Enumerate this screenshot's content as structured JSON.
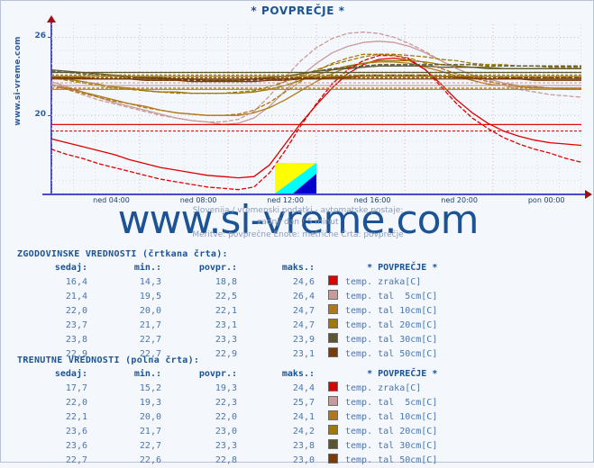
{
  "chart_data": {
    "type": "line",
    "title": "* POVPREČJE *",
    "subtitle_line1": "Slovenija / vremenski podatki - avtomatske postaje:",
    "subtitle_line2": "zadnji dan / 5 minut",
    "subtitle_line3": "Meritve: povprečne  Enote: metrične  Črta: povprečje",
    "xlabel": "",
    "ylabel": "",
    "ylim": [
      14,
      27
    ],
    "yticks": [
      20,
      26
    ],
    "ytick_labels": [
      "20",
      "26"
    ],
    "xticks": [
      "ned 04:00",
      "ned 08:00",
      "ned 12:00",
      "ned 16:00",
      "ned 20:00",
      "pon 00:00"
    ],
    "grid": true,
    "legend_position": "below-table",
    "series": [
      {
        "name": "temp. zraka[C]",
        "style": "solid",
        "group": "trenutne",
        "color": "#dd0000",
        "values": [
          18.2,
          17.9,
          17.6,
          17.3,
          17.0,
          16.6,
          16.3,
          16.0,
          15.8,
          15.6,
          15.4,
          15.3,
          15.2,
          15.3,
          16.2,
          17.8,
          19.4,
          20.8,
          22.1,
          23.2,
          23.9,
          24.3,
          24.4,
          24.2,
          23.5,
          22.4,
          21.2,
          20.2,
          19.4,
          18.8,
          18.4,
          18.1,
          17.9,
          17.8,
          17.7
        ]
      },
      {
        "name": "temp. tal  5cm[C]",
        "style": "solid",
        "group": "trenutne",
        "color": "#c99a9a",
        "values": [
          22.6,
          22.2,
          21.8,
          21.4,
          21.0,
          20.7,
          20.4,
          20.1,
          19.8,
          19.6,
          19.5,
          19.3,
          19.4,
          19.8,
          20.7,
          21.9,
          23.0,
          24.0,
          24.8,
          25.3,
          25.6,
          25.7,
          25.6,
          25.3,
          24.8,
          24.2,
          23.6,
          23.1,
          22.8,
          22.5,
          22.3,
          22.2,
          22.1,
          22.0,
          22.0
        ]
      },
      {
        "name": "temp. tal 10cm[C]",
        "style": "solid",
        "group": "trenutne",
        "color": "#b07818",
        "values": [
          22.4,
          22.1,
          21.8,
          21.5,
          21.2,
          20.9,
          20.7,
          20.4,
          20.2,
          20.1,
          20.0,
          20.0,
          20.0,
          20.2,
          20.6,
          21.2,
          21.9,
          22.6,
          23.2,
          23.7,
          24.0,
          24.1,
          24.1,
          24.0,
          23.7,
          23.4,
          23.0,
          22.7,
          22.4,
          22.3,
          22.2,
          22.1,
          22.1,
          22.1,
          22.1
        ]
      },
      {
        "name": "temp. tal 20cm[C]",
        "style": "solid",
        "group": "trenutne",
        "color": "#a07806",
        "values": [
          23.0,
          22.8,
          22.6,
          22.4,
          22.2,
          22.1,
          21.9,
          21.8,
          21.8,
          21.7,
          21.7,
          21.7,
          21.7,
          21.8,
          22.0,
          22.3,
          22.7,
          23.1,
          23.5,
          23.8,
          24.0,
          24.2,
          24.2,
          24.2,
          24.1,
          23.9,
          23.8,
          23.7,
          23.7,
          23.6,
          23.6,
          23.6,
          23.6,
          23.6,
          23.6
        ]
      },
      {
        "name": "temp. tal 30cm[C]",
        "style": "solid",
        "group": "trenutne",
        "color": "#5c5630",
        "values": [
          23.5,
          23.4,
          23.3,
          23.2,
          23.1,
          23.0,
          22.9,
          22.9,
          22.8,
          22.8,
          22.7,
          22.7,
          22.7,
          22.8,
          22.9,
          23.0,
          23.2,
          23.4,
          23.5,
          23.6,
          23.7,
          23.8,
          23.8,
          23.8,
          23.8,
          23.7,
          23.7,
          23.7,
          23.6,
          23.6,
          23.6,
          23.6,
          23.6,
          23.6,
          23.6
        ]
      },
      {
        "name": "temp. tal 50cm[C]",
        "style": "solid",
        "group": "trenutne",
        "color": "#7a3b06",
        "values": [
          22.9,
          22.9,
          22.9,
          22.8,
          22.8,
          22.8,
          22.7,
          22.7,
          22.7,
          22.6,
          22.6,
          22.6,
          22.6,
          22.6,
          22.7,
          22.7,
          22.8,
          22.8,
          22.9,
          22.9,
          23.0,
          23.0,
          23.0,
          23.0,
          23.0,
          23.0,
          22.9,
          22.9,
          22.8,
          22.8,
          22.8,
          22.7,
          22.7,
          22.7,
          22.7
        ]
      },
      {
        "name": "temp. zraka[C]",
        "style": "dashed",
        "group": "zgodovinske",
        "color": "#dd0000",
        "values": [
          17.4,
          17.0,
          16.7,
          16.3,
          16.0,
          15.7,
          15.4,
          15.1,
          14.9,
          14.7,
          14.5,
          14.4,
          14.3,
          14.5,
          15.6,
          17.3,
          19.2,
          20.9,
          22.4,
          23.5,
          24.2,
          24.6,
          24.6,
          24.3,
          23.5,
          22.2,
          20.9,
          19.8,
          19.0,
          18.3,
          17.8,
          17.4,
          17.1,
          16.7,
          16.4
        ]
      },
      {
        "name": "temp. tal  5cm[C]",
        "style": "dashed",
        "group": "zgodovinske",
        "color": "#c99a9a",
        "values": [
          22.4,
          22.0,
          21.6,
          21.2,
          20.9,
          20.6,
          20.3,
          20.0,
          19.8,
          19.6,
          19.5,
          19.5,
          19.7,
          20.3,
          21.5,
          22.9,
          24.2,
          25.2,
          25.9,
          26.3,
          26.4,
          26.3,
          26.0,
          25.5,
          24.9,
          24.2,
          23.6,
          23.1,
          22.7,
          22.3,
          22.0,
          21.8,
          21.6,
          21.5,
          21.4
        ]
      },
      {
        "name": "temp. tal 10cm[C]",
        "style": "dashed",
        "group": "zgodovinske",
        "color": "#b07818",
        "values": [
          22.3,
          22.0,
          21.7,
          21.4,
          21.1,
          20.9,
          20.6,
          20.4,
          20.2,
          20.1,
          20.0,
          20.0,
          20.1,
          20.4,
          21.0,
          21.8,
          22.6,
          23.4,
          24.0,
          24.4,
          24.7,
          24.7,
          24.6,
          24.4,
          24.0,
          23.6,
          23.2,
          22.9,
          22.6,
          22.4,
          22.3,
          22.2,
          22.1,
          22.0,
          22.0
        ]
      },
      {
        "name": "temp. tal 20cm[C]",
        "style": "dashed",
        "group": "zgodovinske",
        "color": "#a07806",
        "values": [
          22.9,
          22.7,
          22.5,
          22.3,
          22.1,
          22.0,
          21.9,
          21.8,
          21.7,
          21.7,
          21.7,
          21.7,
          21.8,
          21.9,
          22.2,
          22.6,
          23.0,
          23.5,
          23.9,
          24.2,
          24.5,
          24.7,
          24.7,
          24.6,
          24.5,
          24.3,
          24.2,
          24.0,
          23.9,
          23.9,
          23.8,
          23.8,
          23.7,
          23.7,
          23.7
        ]
      },
      {
        "name": "temp. tal 30cm[C]",
        "style": "dashed",
        "group": "zgodovinske",
        "color": "#5c5630",
        "values": [
          23.4,
          23.3,
          23.2,
          23.1,
          23.0,
          22.9,
          22.9,
          22.8,
          22.8,
          22.7,
          22.7,
          22.7,
          22.7,
          22.8,
          22.9,
          23.0,
          23.2,
          23.4,
          23.6,
          23.7,
          23.8,
          23.9,
          23.9,
          23.9,
          23.9,
          23.9,
          23.9,
          23.9,
          23.8,
          23.8,
          23.8,
          23.8,
          23.8,
          23.8,
          23.8
        ]
      },
      {
        "name": "temp. tal 50cm[C]",
        "style": "dashed",
        "group": "zgodovinske",
        "color": "#7a3b06",
        "values": [
          22.9,
          22.9,
          22.8,
          22.8,
          22.8,
          22.8,
          22.7,
          22.7,
          22.7,
          22.7,
          22.7,
          22.7,
          22.7,
          22.7,
          22.8,
          22.8,
          22.9,
          22.9,
          23.0,
          23.0,
          23.1,
          23.1,
          23.1,
          23.1,
          23.1,
          23.0,
          23.0,
          23.0,
          23.0,
          22.9,
          22.9,
          22.9,
          22.9,
          22.9,
          22.9
        ]
      }
    ]
  },
  "vertical_label": "www.si-vreme.com",
  "watermark": "www.si-vreme.com",
  "logo": {
    "name": "si-vreme-logo",
    "colors": [
      "#ffff00",
      "#00ffff",
      "#0000cc"
    ]
  },
  "tables": {
    "historical": {
      "caption": "ZGODOVINSKE VREDNOSTI (črtkana črta):",
      "headers": {
        "now": "sedaj:",
        "min": "min.:",
        "avg": "povpr.:",
        "max": "maks.:",
        "series": "* POVPREČJE *"
      },
      "rows": [
        {
          "now": "16,4",
          "min": "14,3",
          "avg": "18,8",
          "max": "24,6",
          "color": "#dd0000",
          "label": "temp. zraka[C]"
        },
        {
          "now": "21,4",
          "min": "19,5",
          "avg": "22,5",
          "max": "26,4",
          "color": "#c99a9a",
          "label": "temp. tal  5cm[C]"
        },
        {
          "now": "22,0",
          "min": "20,0",
          "avg": "22,1",
          "max": "24,7",
          "color": "#b07818",
          "label": "temp. tal 10cm[C]"
        },
        {
          "now": "23,7",
          "min": "21,7",
          "avg": "23,1",
          "max": "24,7",
          "color": "#a07806",
          "label": "temp. tal 20cm[C]"
        },
        {
          "now": "23,8",
          "min": "22,7",
          "avg": "23,3",
          "max": "23,9",
          "color": "#5c5630",
          "label": "temp. tal 30cm[C]"
        },
        {
          "now": "22,9",
          "min": "22,7",
          "avg": "22,9",
          "max": "23,1",
          "color": "#7a3b06",
          "label": "temp. tal 50cm[C]"
        }
      ]
    },
    "current": {
      "caption": "TRENUTNE VREDNOSTI (polna črta):",
      "headers": {
        "now": "sedaj:",
        "min": "min.:",
        "avg": "povpr.:",
        "max": "maks.:",
        "series": "* POVPREČJE *"
      },
      "rows": [
        {
          "now": "17,7",
          "min": "15,2",
          "avg": "19,3",
          "max": "24,4",
          "color": "#dd0000",
          "label": "temp. zraka[C]"
        },
        {
          "now": "22,0",
          "min": "19,3",
          "avg": "22,3",
          "max": "25,7",
          "color": "#c99a9a",
          "label": "temp. tal  5cm[C]"
        },
        {
          "now": "22,1",
          "min": "20,0",
          "avg": "22,0",
          "max": "24,1",
          "color": "#b07818",
          "label": "temp. tal 10cm[C]"
        },
        {
          "now": "23,6",
          "min": "21,7",
          "avg": "23,0",
          "max": "24,2",
          "color": "#a07806",
          "label": "temp. tal 20cm[C]"
        },
        {
          "now": "23,6",
          "min": "22,7",
          "avg": "23,3",
          "max": "23,8",
          "color": "#5c5630",
          "label": "temp. tal 30cm[C]"
        },
        {
          "now": "22,7",
          "min": "22,6",
          "avg": "22,8",
          "max": "23,0",
          "color": "#7a3b06",
          "label": "temp. tal 50cm[C]"
        }
      ]
    }
  }
}
